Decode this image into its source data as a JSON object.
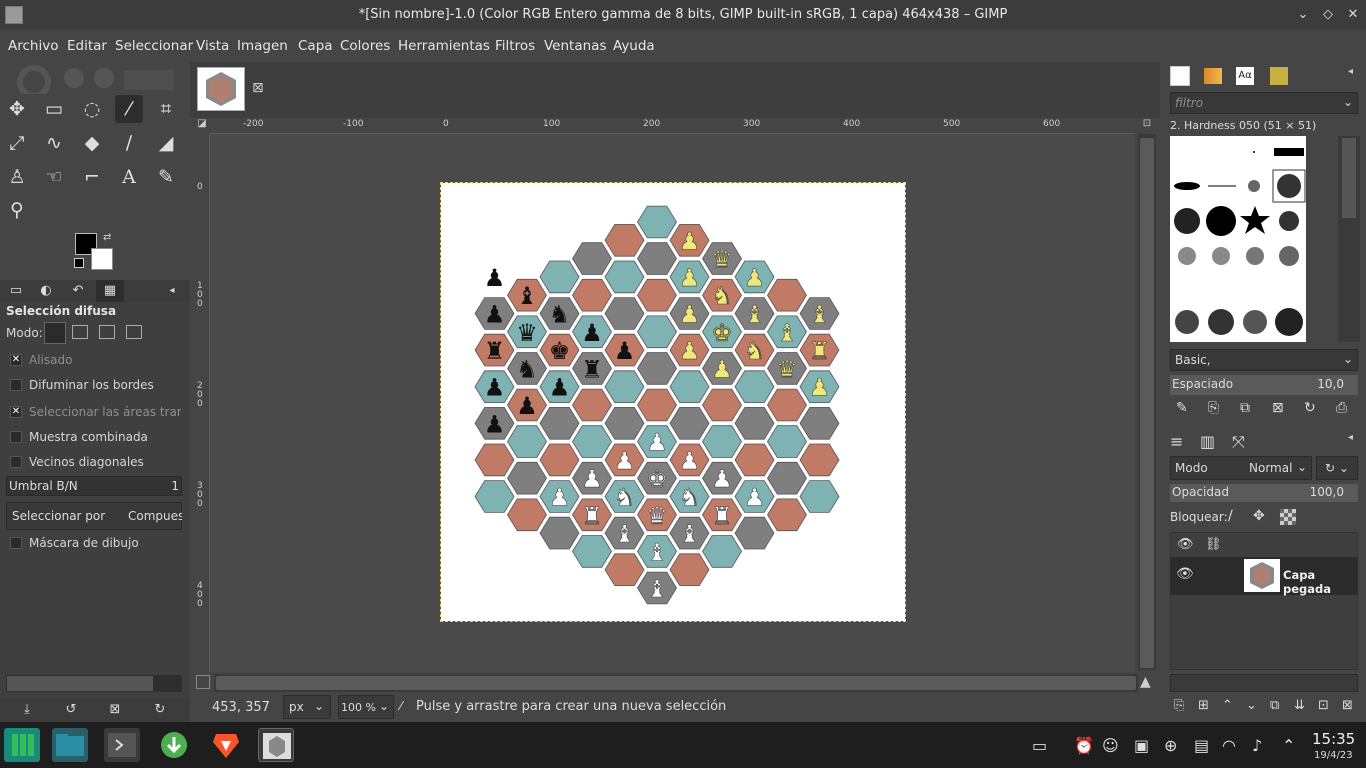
{
  "window": {
    "title": "*[Sin nombre]-1.0 (Color RGB Entero gamma de 8 bits, GIMP built-in sRGB, 1 capa) 464x438 – GIMP"
  },
  "menubar": {
    "items": [
      "Archivo",
      "Editar",
      "Seleccionar",
      "Vista",
      "Imagen",
      "Capa",
      "Colores",
      "Herramientas",
      "Filtros",
      "Ventanas",
      "Ayuda"
    ]
  },
  "tool_options": {
    "title": "Selección difusa",
    "mode_label": "Modo:",
    "antialias": "Alisado",
    "feather": "Difuminar los bordes",
    "select_transparent": "Seleccionar las áreas transpar",
    "sample_merged": "Muestra combinada",
    "diagonal": "Vecinos diagonales",
    "threshold_label": "Umbral B/N",
    "threshold_value": "1",
    "select_by_label": "Seleccionar por",
    "select_by_value": "Compuest",
    "draw_mask": "Máscara de dibujo"
  },
  "rulers": {
    "h_labels": [
      "-200",
      "-100",
      "0",
      "100",
      "200",
      "300",
      "400",
      "500",
      "600"
    ],
    "v_labels": [
      "0",
      "100",
      "200",
      "300",
      "400"
    ]
  },
  "status": {
    "coords": "453, 357",
    "unit": "px",
    "zoom": "100 %",
    "message": "Pulse y arrastre para crear una nueva selección"
  },
  "brushes": {
    "filter_placeholder": "filtro",
    "current": "2. Hardness 050 (51 × 51)",
    "tag": "Basic,",
    "spacing_label": "Espaciado",
    "spacing_value": "10,0"
  },
  "layers": {
    "mode_label": "Modo",
    "mode_value": "Normal",
    "opacity_label": "Opacidad",
    "opacity_value": "100,0",
    "lock_label": "Bloquear:",
    "layer_name": "Capa pegada"
  },
  "clock": {
    "time": "15:35",
    "date": "19/4/23"
  },
  "colors": {
    "hex_grey": "#7f7f7f",
    "hex_teal": "#7fb3b3",
    "hex_terracotta": "#c07a66",
    "piece_yellow": "#f0e878"
  }
}
